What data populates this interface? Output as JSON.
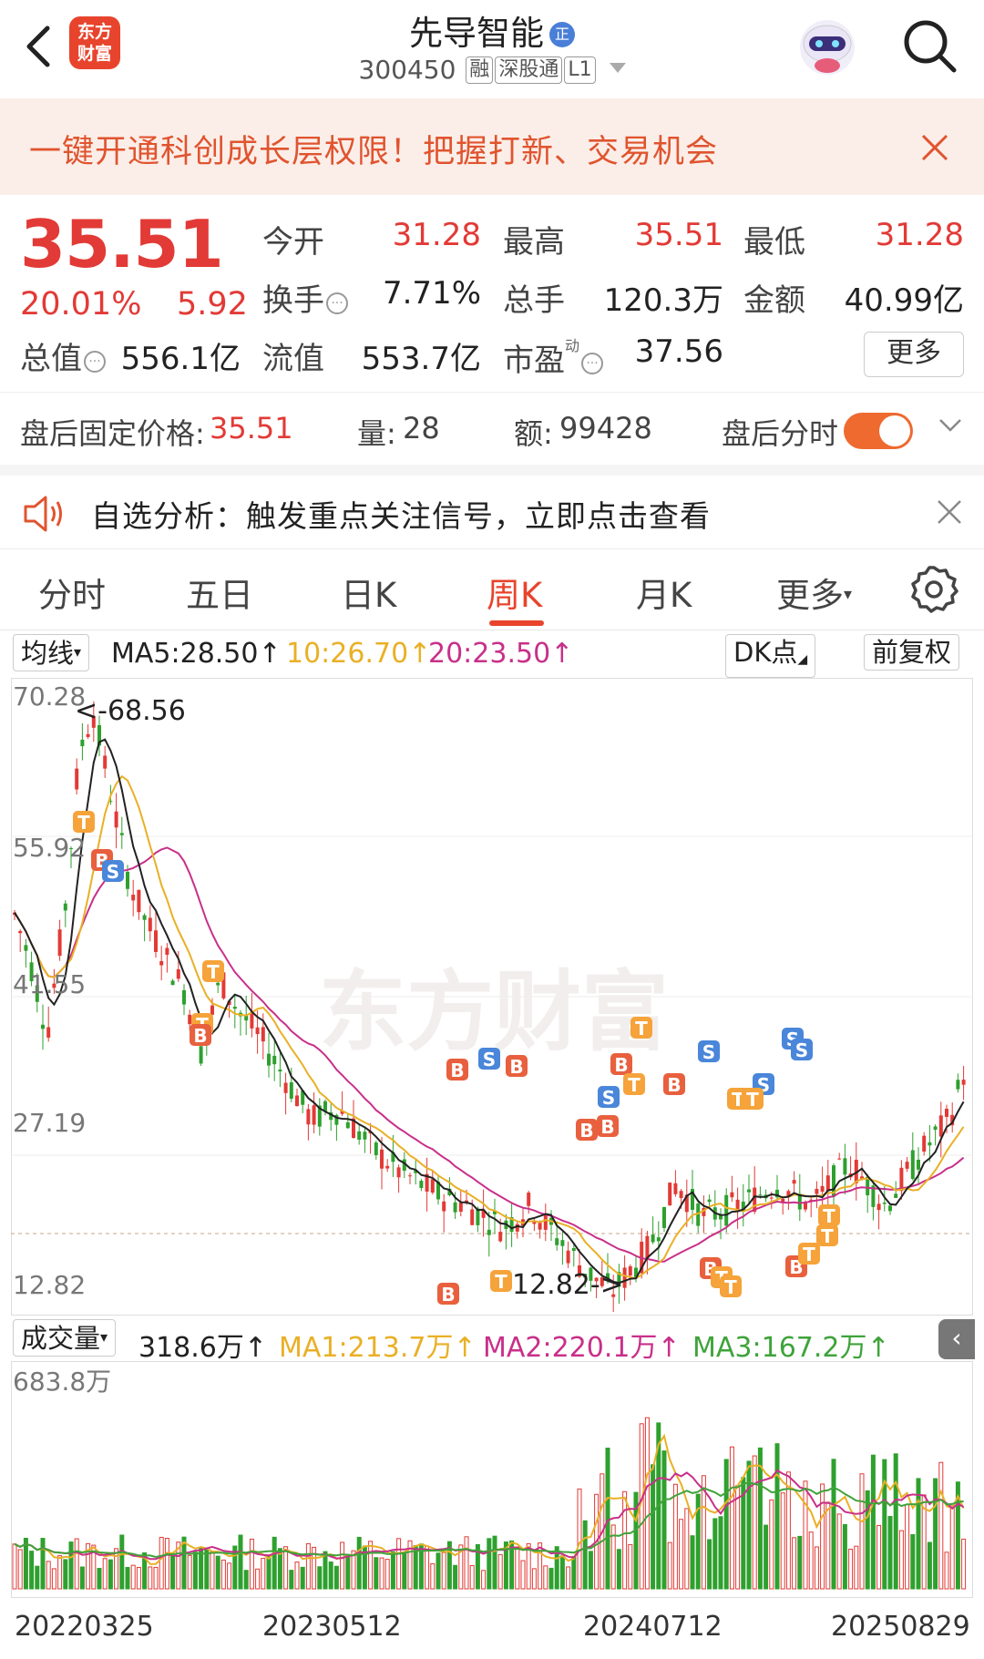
{
  "header": {
    "logo_text": "东方\n财富",
    "stock_name": "先导智能",
    "badge": "正",
    "code": "300450",
    "tags": [
      "融",
      "深股通",
      "L1"
    ]
  },
  "banner": {
    "text": "一键开通科创成长层权限！把握打新、交易机会"
  },
  "quote": {
    "price": "35.51",
    "change_pct": "20.01%",
    "change": "5.92",
    "fields": [
      {
        "label": "今开",
        "value": "31.28",
        "red": true
      },
      {
        "label": "最高",
        "value": "35.51",
        "red": true
      },
      {
        "label": "最低",
        "value": "31.28",
        "red": true
      },
      {
        "label": "换手",
        "value": "7.71%",
        "red": false
      },
      {
        "label": "总手",
        "value": "120.3万",
        "red": false
      },
      {
        "label": "金额",
        "value": "40.99亿",
        "red": false
      },
      {
        "label": "总值",
        "value": "556.1亿",
        "red": false
      },
      {
        "label": "流值",
        "value": "553.7亿",
        "red": false
      },
      {
        "label": "市盈",
        "value": "37.56",
        "red": false
      }
    ],
    "more_label": "更多",
    "dong": "动"
  },
  "after_hours": {
    "price_label": "盘后固定价格:",
    "price_value": "35.51",
    "vol_label": "量:",
    "vol_value": "28",
    "amt_label": "额:",
    "amt_value": "99428",
    "toggle_label": "盘后分时",
    "toggle_on": true
  },
  "alert": {
    "text": "自选分析：触发重点关注信号，立即点击查看"
  },
  "tabs": [
    "分时",
    "五日",
    "日K",
    "周K",
    "月K",
    "更多"
  ],
  "active_tab": "周K",
  "ma_bar": {
    "selector": "均线",
    "ma5": "MA5:28.50",
    "ma10": "10:26.70",
    "ma20": "20:23.50",
    "dk_label": "DK点",
    "fq_label": "前复权",
    "arrow": "↑",
    "colors": {
      "ma5": "#222222",
      "ma10": "#e9b026",
      "ma20": "#c8308a"
    }
  },
  "kline": {
    "y_labels": [
      "70.28",
      "55.92",
      "41.55",
      "27.19",
      "12.82"
    ],
    "high_marker": "<-68.56",
    "low_marker": "12.82->",
    "watermark": "东方财富"
  },
  "volume_bar": {
    "selector": "成交量",
    "value": "318.6万",
    "ma1": "MA1:213.7万",
    "ma2": "MA2:220.1万",
    "ma3": "MA3:167.2万",
    "max_label": "683.8万",
    "arrow": "↑",
    "colors": {
      "ma1": "#e9b026",
      "ma2": "#c8308a",
      "ma3": "#3fa33a"
    }
  },
  "x_dates": [
    "20220325",
    "20230512",
    "20240712",
    "20250829"
  ],
  "colors": {
    "up": "#e23a36",
    "down": "#2ea02e",
    "accent": "#e8442d"
  }
}
